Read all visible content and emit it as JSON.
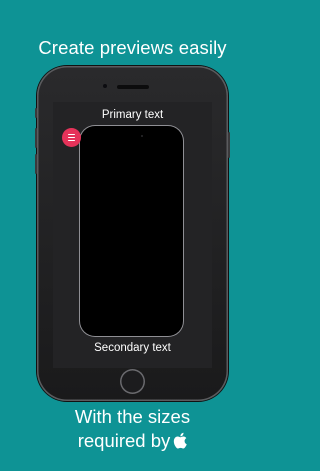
{
  "header": {
    "title": "Create previews easily"
  },
  "device_screen": {
    "primary_text": "Primary text",
    "secondary_text": "Secondary text",
    "menu_button_icon": "hamburger-icon"
  },
  "footer": {
    "line1": "With the sizes",
    "line2": "required by",
    "brand_icon": "apple-logo-icon"
  },
  "colors": {
    "background": "#0e9395",
    "menu_button": "#e5335a",
    "text": "#ffffff"
  }
}
